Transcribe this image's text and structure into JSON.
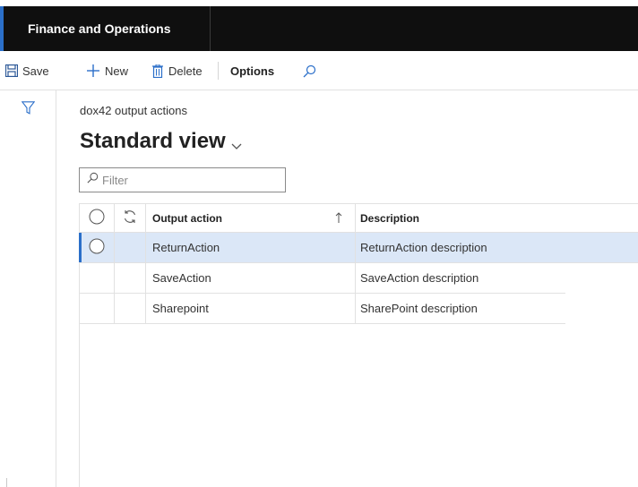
{
  "app": {
    "title": "Finance and Operations"
  },
  "toolbar": {
    "save_label": "Save",
    "new_label": "New",
    "delete_label": "Delete",
    "options_label": "Options"
  },
  "page": {
    "caption": "dox42 output actions",
    "view_name": "Standard view"
  },
  "filter": {
    "placeholder": "Filter",
    "value": ""
  },
  "grid": {
    "columns": {
      "output_action": "Output action",
      "description": "Description"
    },
    "rows": [
      {
        "output_action": "ReturnAction",
        "description": "ReturnAction description",
        "selected": true
      },
      {
        "output_action": "SaveAction",
        "description": "SaveAction description",
        "selected": false
      },
      {
        "output_action": "Sharepoint",
        "description": "SharePoint description",
        "selected": false
      }
    ]
  },
  "colors": {
    "accent": "#2b6fc9",
    "selected_row": "#dbe7f7",
    "topbar": "#0f0f0f"
  }
}
